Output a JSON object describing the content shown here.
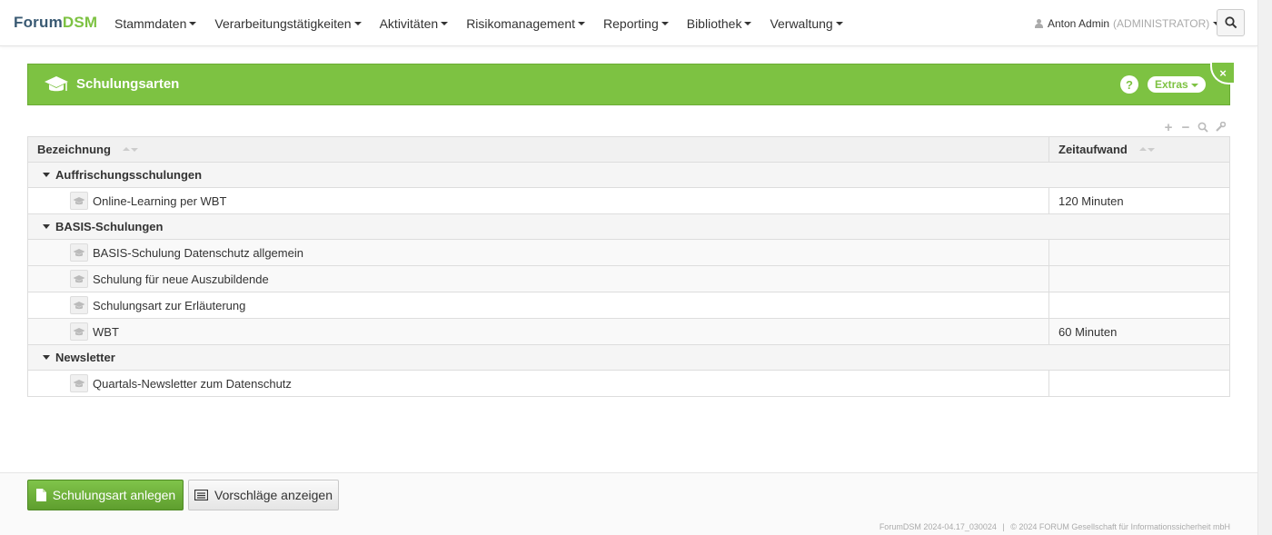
{
  "brand": {
    "part1": "Forum",
    "part2": "DSM"
  },
  "nav": [
    {
      "label": "Stammdaten"
    },
    {
      "label": "Verarbeitungstätigkeiten"
    },
    {
      "label": "Aktivitäten"
    },
    {
      "label": "Risikomanagement"
    },
    {
      "label": "Reporting"
    },
    {
      "label": "Bibliothek"
    },
    {
      "label": "Verwaltung"
    }
  ],
  "user": {
    "name": "Anton Admin",
    "role": "(ADMINISTRATOR)"
  },
  "panel": {
    "title": "Schulungsarten",
    "help": "?",
    "extras": "Extras",
    "close": "×"
  },
  "table": {
    "columns": [
      "Bezeichnung",
      "Zeitaufwand"
    ],
    "groups": [
      {
        "name": "Auffrischungsschulungen",
        "rows": [
          {
            "name": "Online-Learning per WBT",
            "time": "120 Minuten"
          }
        ]
      },
      {
        "name": "BASIS-Schulungen",
        "rows": [
          {
            "name": "BASIS-Schulung Datenschutz allgemein",
            "time": ""
          },
          {
            "name": "Schulung für neue Auszubildende",
            "time": ""
          },
          {
            "name": "Schulungsart zur Erläuterung",
            "time": ""
          },
          {
            "name": "WBT",
            "time": "60 Minuten"
          }
        ]
      },
      {
        "name": "Newsletter",
        "rows": [
          {
            "name": "Quartals-Newsletter zum Datenschutz",
            "time": ""
          }
        ]
      }
    ]
  },
  "actions": {
    "create": "Schulungsart anlegen",
    "suggest": "Vorschläge anzeigen"
  },
  "footer": {
    "version": "ForumDSM 2024-04.17_030024",
    "copyright": "© 2024 FORUM Gesellschaft für Informationssicherheit mbH"
  },
  "colors": {
    "accent": "#7dc242",
    "brand_dark": "#3a5a73"
  }
}
